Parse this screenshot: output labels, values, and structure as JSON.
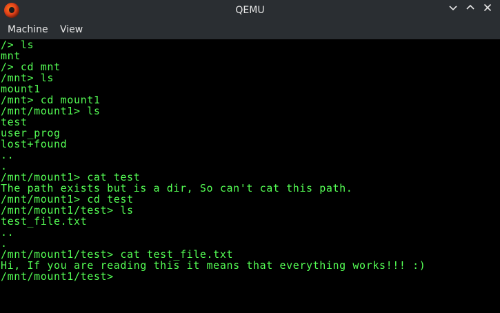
{
  "window": {
    "title": "QEMU"
  },
  "menubar": {
    "items": [
      "Machine",
      "View"
    ]
  },
  "terminal": {
    "lines": [
      "/> ls",
      "mnt",
      "/> cd mnt",
      "/mnt> ls",
      "mount1",
      "/mnt> cd mount1",
      "/mnt/mount1> ls",
      "test",
      "user_prog",
      "lost+found",
      "..",
      ".",
      "/mnt/mount1> cat test",
      "The path exists but is a dir, So can't cat this path.",
      "/mnt/mount1> cd test",
      "/mnt/mount1/test> ls",
      "test_file.txt",
      "..",
      ".",
      "/mnt/mount1/test> cat test_file.txt",
      "Hi, If you are reading this it means that everything works!!! :)",
      "/mnt/mount1/test>"
    ],
    "text_color": "#55ff55",
    "background": "#000000"
  },
  "icons": {
    "app": "qemu-logo-icon",
    "minimize": "chevron-down-icon",
    "maximize": "chevron-up-icon",
    "close": "close-icon"
  }
}
